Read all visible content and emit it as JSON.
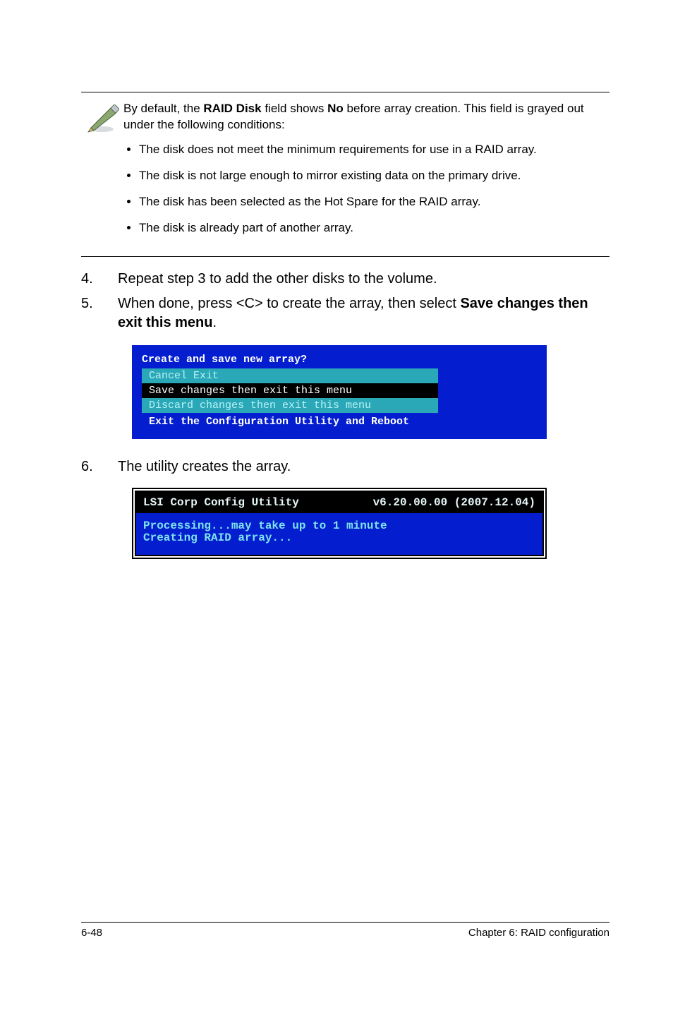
{
  "note": {
    "intro_before_bold1": "By default, the ",
    "bold1": "RAID Disk",
    "intro_mid": " field shows ",
    "bold2": "No",
    "intro_after": " before array creation. This field is grayed out under the following conditions:",
    "bullets": [
      "The disk does not meet the minimum requirements for use in a RAID array.",
      "The disk is not large enough to mirror existing data on the primary drive.",
      "The disk has been selected as the Hot Spare for the RAID array.",
      "The disk is already part of another array."
    ]
  },
  "steps": {
    "s4": {
      "num": "4.",
      "text": "Repeat step 3 to add the other disks to the volume."
    },
    "s5": {
      "num": "5.",
      "pre": "When done, press <C> to create the array, then select ",
      "bold": "Save changes then exit this menu",
      "post": "."
    },
    "s6": {
      "num": "6.",
      "text": "The utility creates the array."
    }
  },
  "dialog1": {
    "title": "Create and save new array?",
    "opt_cancel": "Cancel Exit",
    "opt_save": "Save changes then exit this menu",
    "opt_discard": "Discard changes then exit this menu",
    "opt_exit": "Exit the Configuration Utility and Reboot"
  },
  "dialog2": {
    "header_left": "LSI Corp Config Utility",
    "header_right": "v6.20.00.00 (2007.12.04)",
    "body": "Processing...may take up to 1 minute\nCreating RAID array..."
  },
  "footer": {
    "left": "6-48",
    "right": "Chapter 6: RAID configuration"
  }
}
